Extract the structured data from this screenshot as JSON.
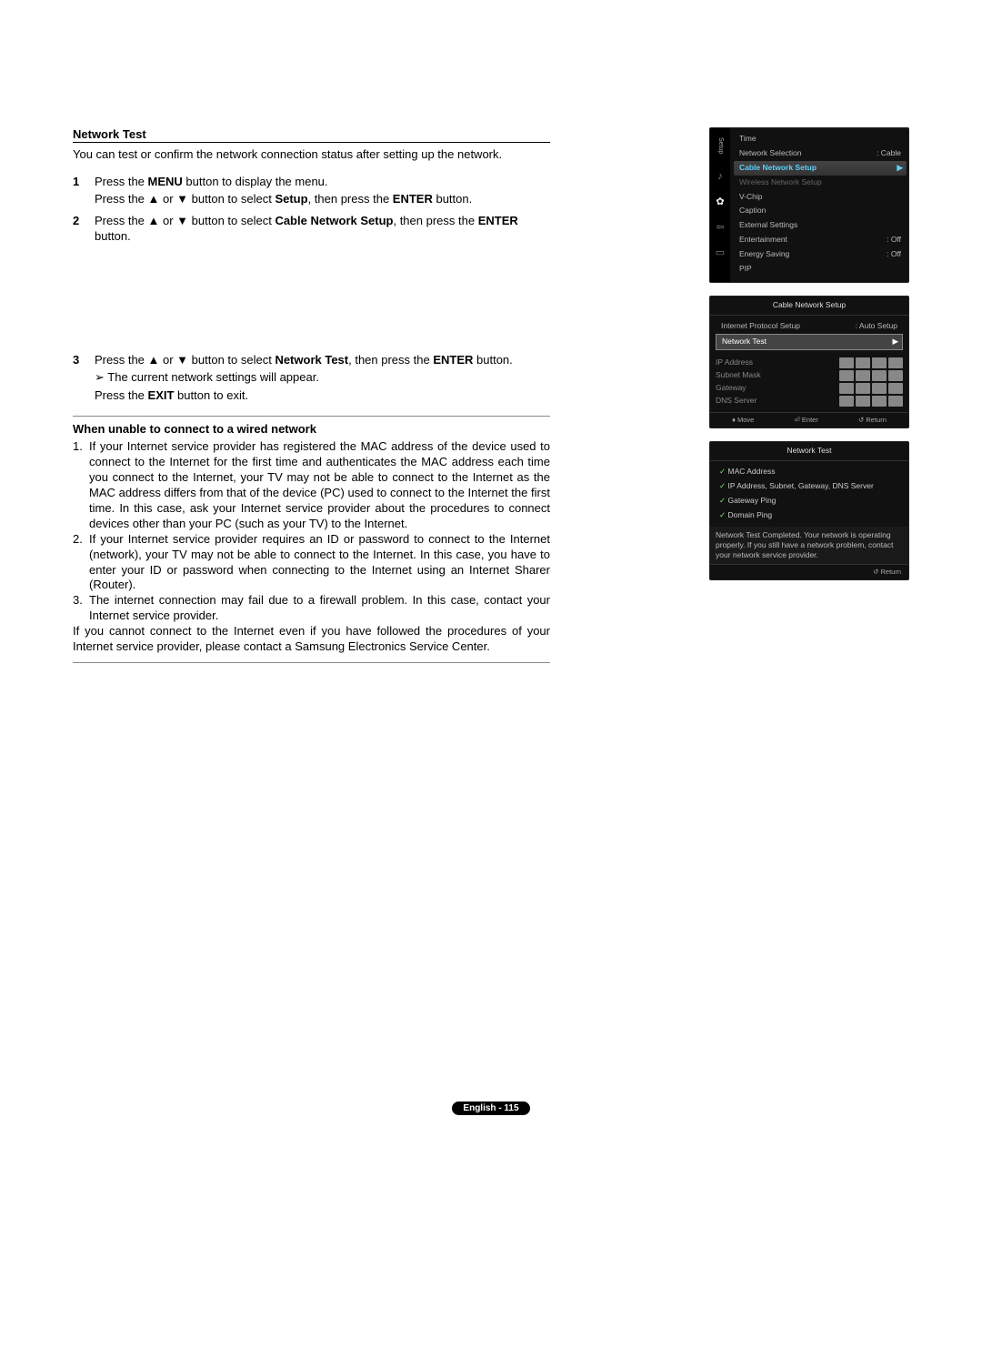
{
  "section_title": "Network Test",
  "intro": "You can test or confirm the network connection status after setting up the network.",
  "steps": [
    {
      "num": "1",
      "lines": [
        "Press the <b>MENU</b> button to display the menu.",
        "Press the ▲ or ▼ button to select <b>Setup</b>, then press the <b>ENTER</b> button."
      ]
    },
    {
      "num": "2",
      "lines": [
        "Press the ▲ or ▼ button to select <b>Cable Network Setup</b>, then press the <b>ENTER</b> button."
      ]
    },
    {
      "num": "3",
      "lines": [
        "Press the ▲ or ▼ button to select <b>Network Test</b>, then press the <b>ENTER</b> button.",
        "<span class='arrow-note'></span>The current network settings will appear.",
        "Press the <b>EXIT</b> button to exit."
      ]
    }
  ],
  "trouble_heading": "When unable to connect to a wired network",
  "trouble_items": [
    "If your Internet service provider has registered the MAC address of the device used to connect to the Internet for the first time and authenticates the MAC address each time you connect to the Internet, your TV may not be able to connect to the Internet as the MAC address differs from that of the device (PC) used to connect to the Internet the first time. In this case, ask your Internet service provider about the procedures to connect devices other than your PC (such as your TV) to the Internet.",
    "If your Internet service provider requires an ID or password to connect to the Internet (network), your TV may not be able to connect to the Internet. In this case, you have to enter your ID or password when connecting to the Internet using an Internet Sharer (Router).",
    "The internet connection may fail due to a firewall problem. In this case, contact your Internet service provider."
  ],
  "trouble_after": "If you cannot connect to the Internet even if you have followed the procedures of your Internet service provider, please contact a Samsung Electronics Service Center.",
  "osd1": {
    "vtext": "Setup",
    "items": [
      {
        "label": "Time",
        "val": ""
      },
      {
        "label": "Network Selection",
        "val": ": Cable"
      },
      {
        "label": "Cable Network Setup",
        "val": "",
        "hl": true
      },
      {
        "label": "Wireless Network Setup",
        "val": "",
        "dim": true
      },
      {
        "label": "V-Chip",
        "val": ""
      },
      {
        "label": "Caption",
        "val": ""
      },
      {
        "label": "External Settings",
        "val": ""
      },
      {
        "label": "Entertainment",
        "val": ": Off"
      },
      {
        "label": "Energy Saving",
        "val": ": Off"
      },
      {
        "label": "PIP",
        "val": ""
      }
    ]
  },
  "osd2": {
    "title": "Cable Network Setup",
    "proto_label": "Internet Protocol Setup",
    "proto_val": ": Auto Setup",
    "sel_label": "Network Test",
    "ip_rows": [
      "IP Address",
      "Subnet Mask",
      "Gateway",
      "DNS Server"
    ],
    "footer": {
      "move": "Move",
      "enter": "Enter",
      "return": "Return"
    }
  },
  "osd3": {
    "title": "Network Test",
    "checks": [
      "MAC Address",
      "IP Address, Subnet, Gateway, DNS Server",
      "Gateway Ping",
      "Domain Ping"
    ],
    "msg": "Network Test Completed.\nYour network is operating properly. If you still have a network problem, contact your network service provider.",
    "return": "Return"
  },
  "footer_label": "English - 115"
}
